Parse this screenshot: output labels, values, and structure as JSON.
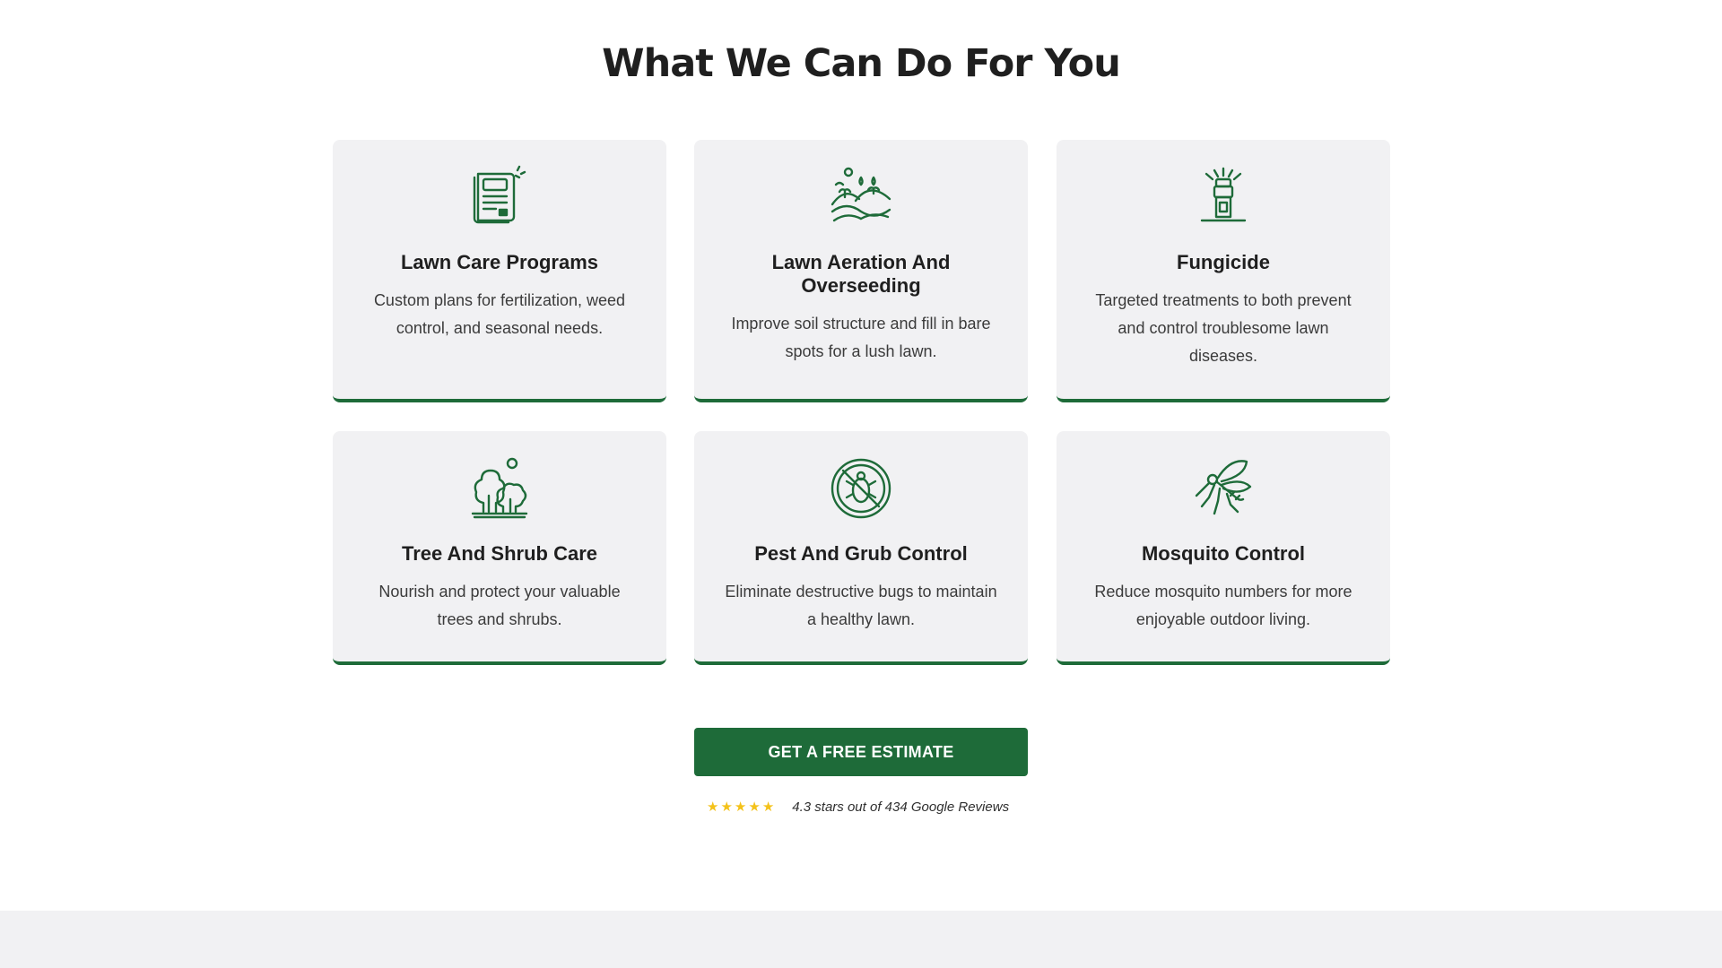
{
  "section": {
    "title": "What We Can Do For You"
  },
  "services": [
    {
      "title": "Lawn Care Programs",
      "description": "Custom plans for fertilization, weed control, and seasonal needs.",
      "icon": "clipboard-plan-icon"
    },
    {
      "title": "Lawn Aeration And Overseeding",
      "description": "Improve soil structure and fill in bare spots for a lush lawn.",
      "icon": "seedling-hills-icon"
    },
    {
      "title": "Fungicide",
      "description": "Targeted treatments to both prevent and control troublesome lawn diseases.",
      "icon": "sprinkler-icon"
    },
    {
      "title": "Tree And Shrub Care",
      "description": "Nourish and protect your valuable trees and shrubs.",
      "icon": "trees-shrubs-icon"
    },
    {
      "title": "Pest And Grub Control",
      "description": "Eliminate destructive bugs to maintain a healthy lawn.",
      "icon": "no-bugs-icon"
    },
    {
      "title": "Mosquito Control",
      "description": "Reduce mosquito numbers for more enjoyable outdoor living.",
      "icon": "mosquito-icon"
    }
  ],
  "cta": {
    "label": "GET A FREE ESTIMATE"
  },
  "rating": {
    "stars": 5,
    "text": "4.3 stars out of 434 Google Reviews"
  },
  "colors": {
    "accent": "#1e6b39",
    "card_bg": "#f1f1f3",
    "star": "#f4c21a"
  }
}
